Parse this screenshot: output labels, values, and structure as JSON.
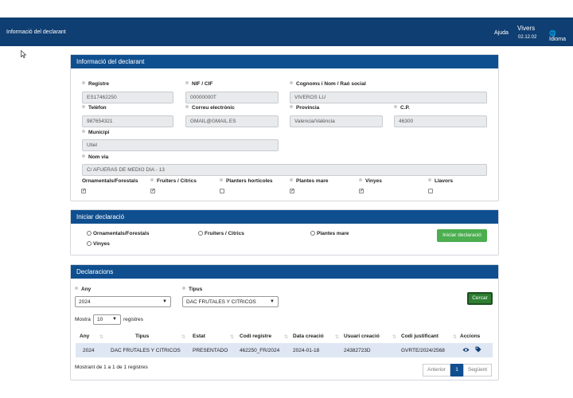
{
  "topbar": {
    "title": "Informació del declarant",
    "help": "Ajuda",
    "user": "Vivers",
    "version": "02.12.02",
    "language": "Idioma"
  },
  "declarant": {
    "header": "Informació del declarant",
    "registre": {
      "label": "Registre",
      "value": "ES17462250"
    },
    "nif": {
      "label": "NIF / CIF",
      "value": "00000000T"
    },
    "nom": {
      "label": "Cognoms i Nom / Raó social",
      "value": "VIVEROS LU"
    },
    "telefon": {
      "label": "Telèfon",
      "value": "987654321"
    },
    "correu": {
      "label": "Correu electrònic",
      "value": "GMAIL@GMAIL.ES"
    },
    "provincia": {
      "label": "Provincia",
      "value": "Valencia/València"
    },
    "cp": {
      "label": "C.P.",
      "value": "46300"
    },
    "municipi": {
      "label": "Municipi",
      "value": "Utiel"
    },
    "nomvia": {
      "label": "Nom via",
      "value": "C/ AFUERAS DE MEDIO DIA - 13"
    },
    "categories": [
      {
        "label": "Ornamentals/Forestals",
        "checked": true
      },
      {
        "label": "Fruiters / Citrics",
        "checked": true
      },
      {
        "label": "Planters horticoles",
        "checked": false
      },
      {
        "label": "Plantes mare",
        "checked": true
      },
      {
        "label": "Vinyes",
        "checked": true
      },
      {
        "label": "Llavors",
        "checked": false
      }
    ]
  },
  "iniciar": {
    "header": "Iniciar declaració",
    "options": [
      "Ornamentals/Forestals",
      "Fruiters / Citrics",
      "Plantes mare",
      "Vinyes"
    ],
    "button": "Iniciar declaració"
  },
  "declaracions": {
    "header": "Declaracions",
    "any_label": "Any",
    "any_value": "2024",
    "tipus_label": "Tipus",
    "tipus_value": "DAC FRUTALES Y CITRICOS",
    "cercar": "Cercar",
    "mostra": "Mostra",
    "mostra_value": "10",
    "registres": "registres",
    "columns": [
      "Any",
      "Tipus",
      "Estat",
      "Codi registre",
      "Data creació",
      "Usuari creació",
      "Codi justificant",
      "Accions"
    ],
    "row": {
      "any": "2024",
      "tipus": "DAC FRUTALES Y CITRICOS",
      "estat": "PRESENTADO",
      "codi": "462250_FR/2024",
      "data": "2024-01-18",
      "usuari": "24382723D",
      "justificant": "GVRTE/2024/2568"
    },
    "summary": "Mostrant de 1 a 1 de 1 registres",
    "prev": "Anterior",
    "page": "1",
    "next": "Següent"
  },
  "colors": {
    "topbar": "#0f3e72",
    "panel_header": "#0f4f8f",
    "green": "#4bae4f"
  }
}
